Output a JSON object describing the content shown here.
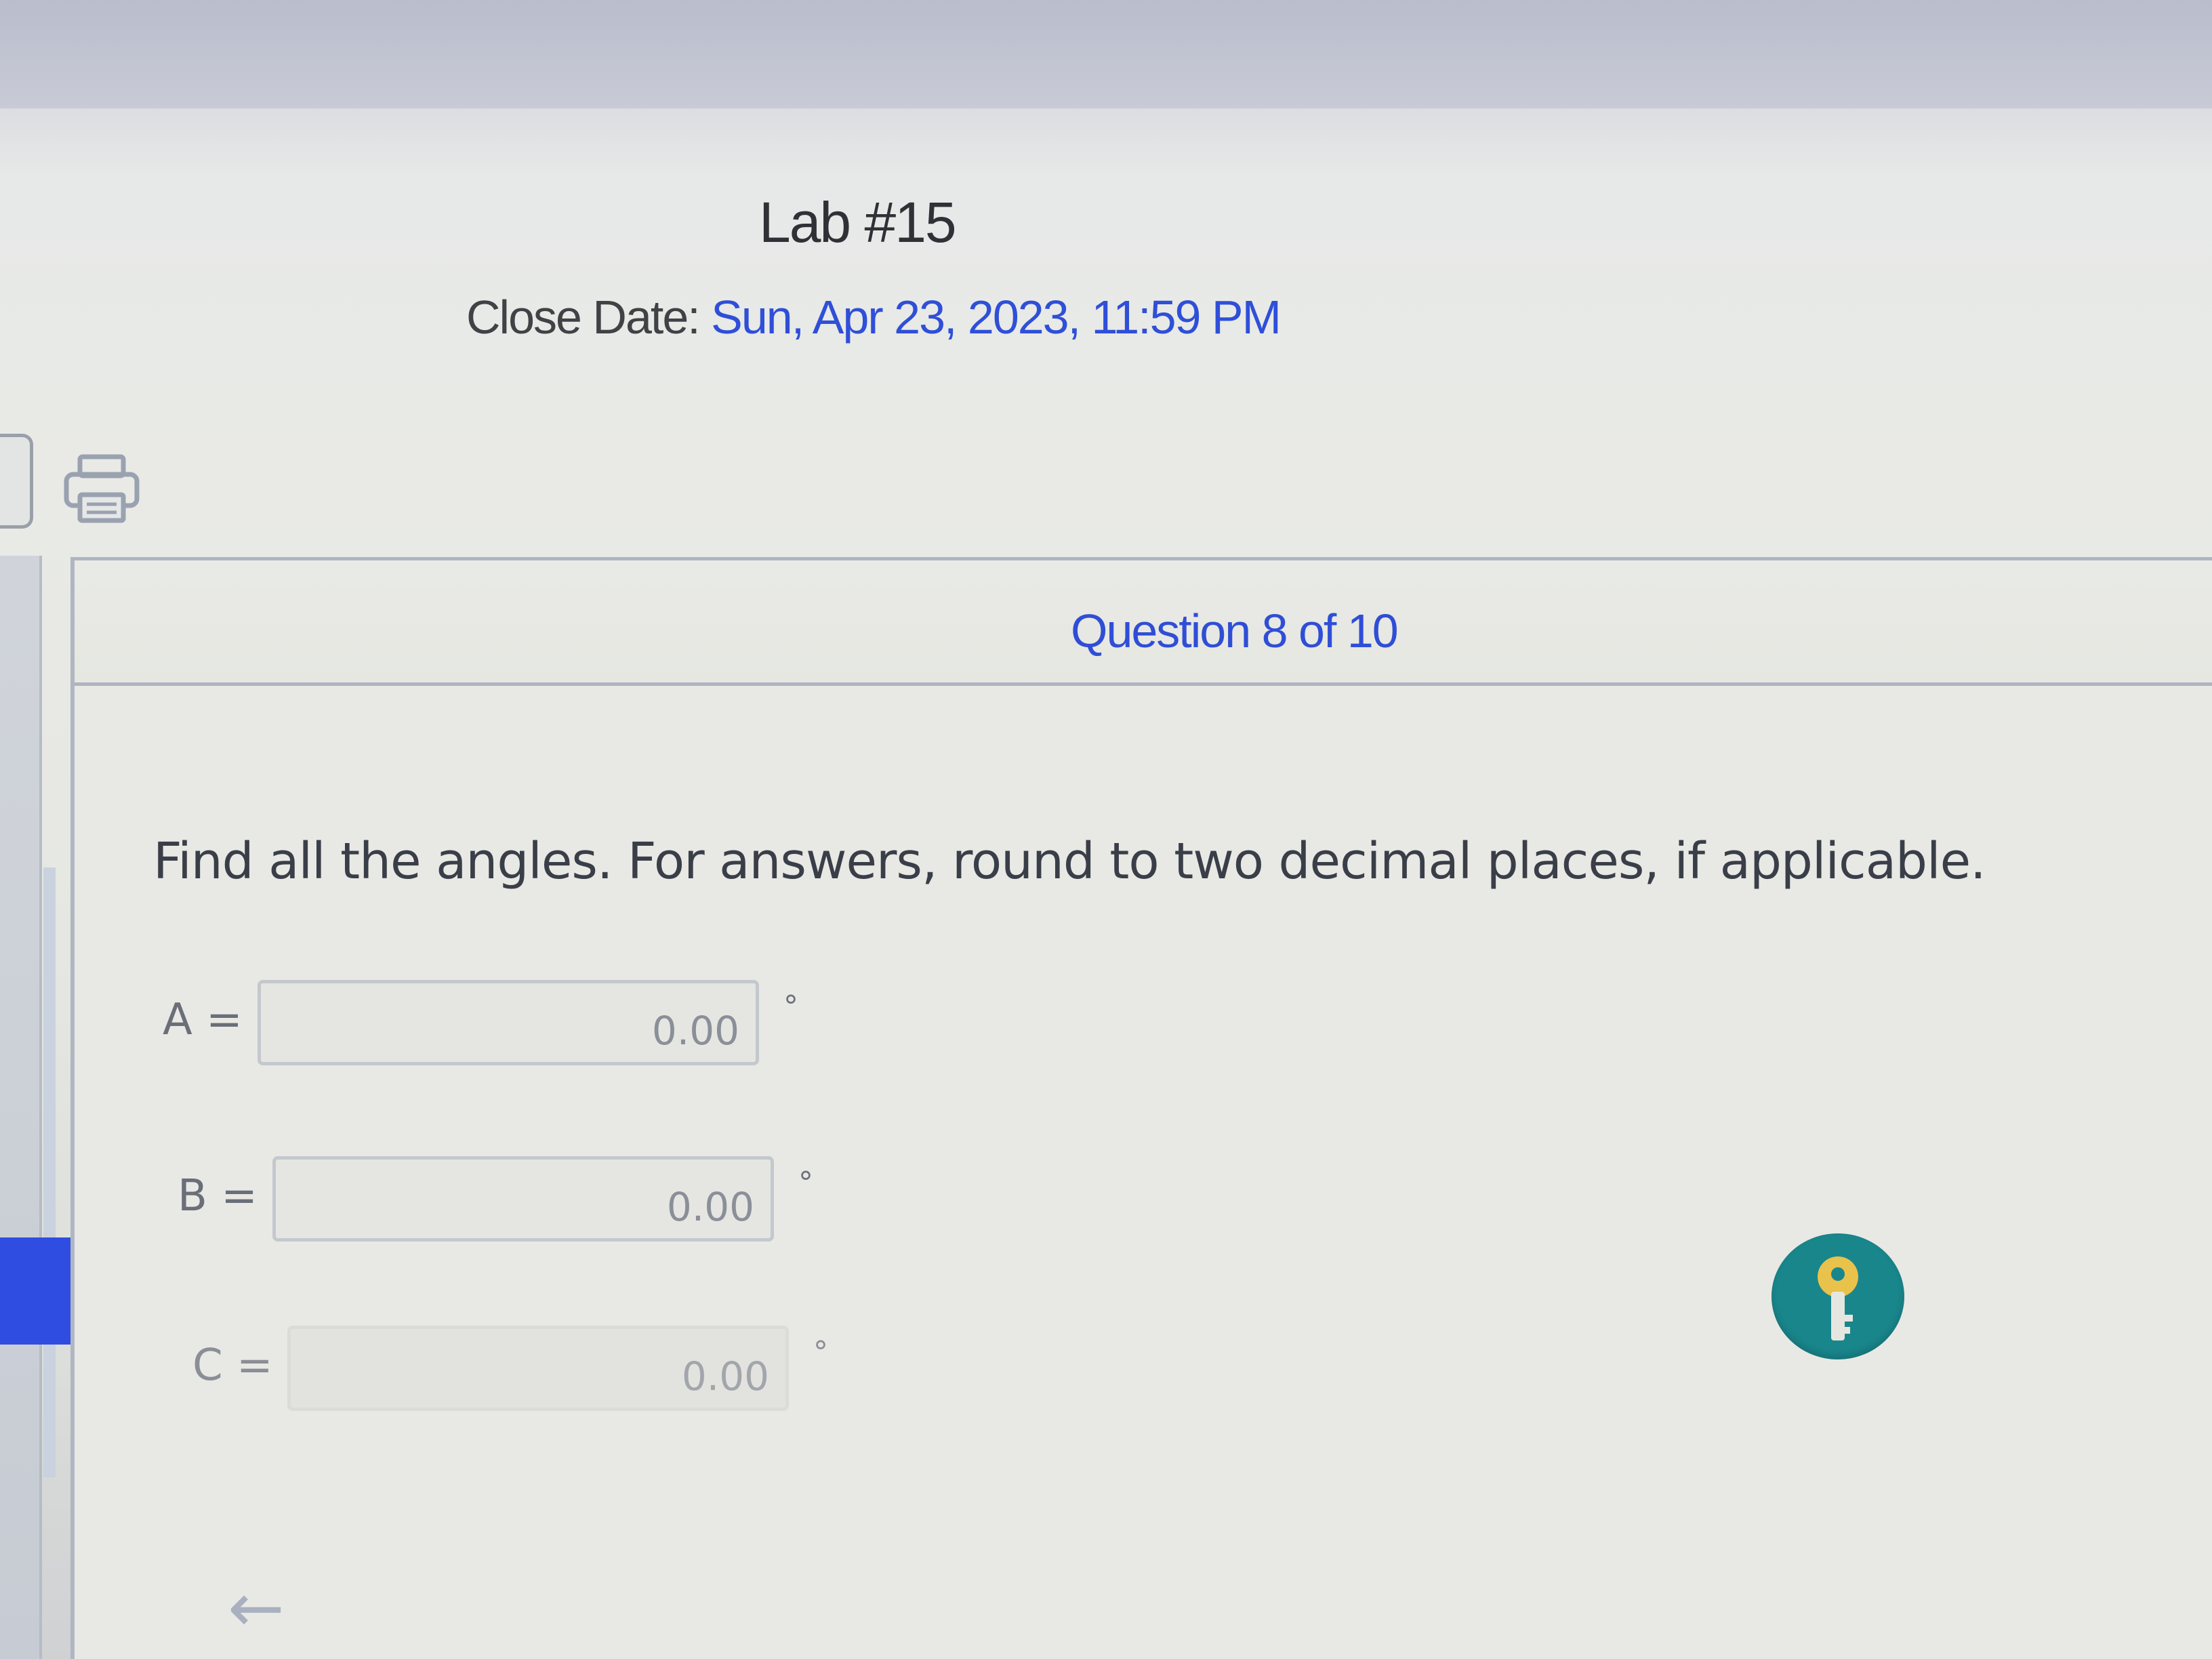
{
  "header": {
    "title": "Lab #15",
    "close_date_label": "Close Date: ",
    "close_date_value": "Sun, Apr 23, 2023, 11:59 PM"
  },
  "toolbar": {
    "print_icon": "printer-icon"
  },
  "question": {
    "counter": "Question 8 of 10",
    "instructions": "Find all the angles. For answers, round to two decimal places, if applicable.",
    "answers": [
      {
        "label": "A =",
        "value": "0.00",
        "unit": "°"
      },
      {
        "label": "B =",
        "value": "0.00",
        "unit": "°"
      },
      {
        "label": "C =",
        "value": "0.00",
        "unit": "°"
      }
    ]
  },
  "actions": {
    "key_icon": "key-icon",
    "back_icon": "arrow-left-icon"
  },
  "colors": {
    "accent_blue": "#2f4fd8",
    "key_button": "#19868c",
    "key_glyph": "#e8c24a"
  }
}
